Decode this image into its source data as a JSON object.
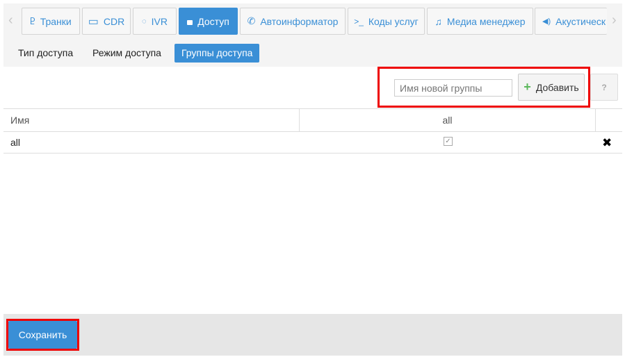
{
  "tabs": [
    {
      "label": "Транки",
      "icon": "trunk-icon",
      "glyph": "Ⴒ"
    },
    {
      "label": "CDR",
      "icon": "credit-card-icon",
      "glyph": "▭"
    },
    {
      "label": "IVR",
      "icon": "chat-icon",
      "glyph": "💬"
    },
    {
      "label": "Доступ",
      "icon": "lock-icon",
      "glyph": "🔒",
      "active": true
    },
    {
      "label": "Автоинформатор",
      "icon": "phone-volume-icon",
      "glyph": "✆"
    },
    {
      "label": "Коды услуг",
      "icon": "terminal-icon",
      "glyph": ">_"
    },
    {
      "label": "Медиа менеджер",
      "icon": "music-icon",
      "glyph": "♫"
    },
    {
      "label": "Акустическ",
      "icon": "volume-icon",
      "glyph": "🔊"
    }
  ],
  "subtabs": [
    "Тип доступа",
    "Режим доступа",
    "Группы доступа"
  ],
  "new_group": {
    "placeholder": "Имя новой группы",
    "value": "",
    "add_label": "Добавить",
    "add_glyph": "+",
    "help_label": "?"
  },
  "table": {
    "headers": [
      "Имя",
      "all"
    ],
    "rows": [
      {
        "name": "all",
        "all_checked": true,
        "delete_glyph": "✖"
      }
    ]
  },
  "footer": {
    "save_label": "Сохранить"
  },
  "colors": {
    "accent": "#3a8fd6",
    "highlight": "#e00000"
  }
}
